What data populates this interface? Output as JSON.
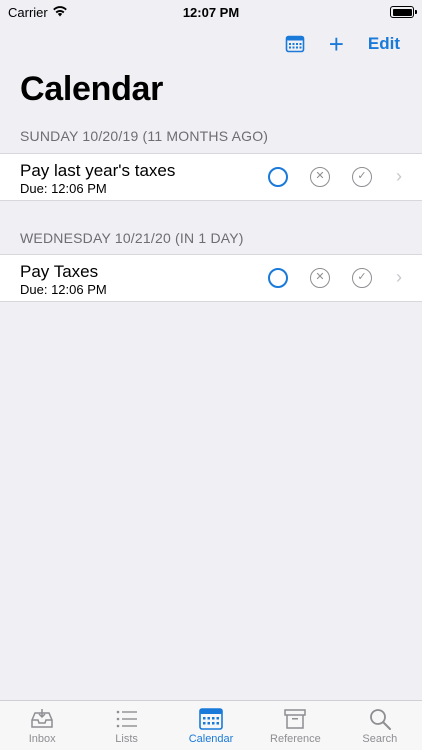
{
  "status": {
    "carrier": "Carrier",
    "time": "12:07 PM"
  },
  "nav": {
    "edit_label": "Edit",
    "add_label": "+"
  },
  "title": "Calendar",
  "sections": [
    {
      "header": "SUNDAY 10/20/19 (11 MONTHS AGO)",
      "task": {
        "title": "Pay last year's taxes",
        "due": "Due: 12:06 PM"
      }
    },
    {
      "header": "WEDNESDAY 10/21/20 (IN 1 DAY)",
      "task": {
        "title": "Pay Taxes",
        "due": "Due: 12:06 PM"
      }
    }
  ],
  "tabs": [
    {
      "label": "Inbox",
      "icon": "inbox-icon",
      "active": false
    },
    {
      "label": "Lists",
      "icon": "list-icon",
      "active": false
    },
    {
      "label": "Calendar",
      "icon": "calendar-icon",
      "active": true
    },
    {
      "label": "Reference",
      "icon": "archive-icon",
      "active": false
    },
    {
      "label": "Search",
      "icon": "search-icon",
      "active": false
    }
  ],
  "colors": {
    "accent": "#1a7ad9",
    "background": "#efeff4",
    "secondary": "#8e8e93"
  }
}
